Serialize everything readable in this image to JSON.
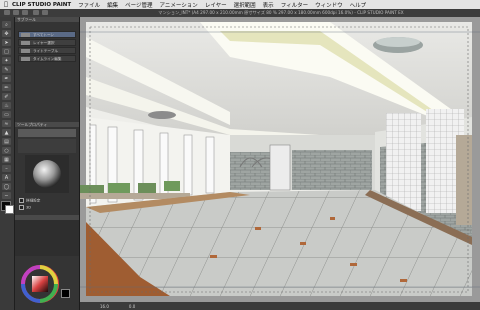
{
  "menubar": {
    "app_name": "CLIP STUDIO PAINT",
    "items": [
      "ファイル",
      "編集",
      "ページ管理",
      "アニメーション",
      "レイヤー",
      "選択範囲",
      "表示",
      "フィルター",
      "ウィンドウ",
      "ヘルプ"
    ]
  },
  "window": {
    "title": "マンション_INT* (A4 297.00 x 210.00mm 原寸サイズ 80 % 297.00 x 180.00mm 600dpi 16.0%) - CLIP STUDIO PAINT EX"
  },
  "subtool_panel": {
    "header": "サブツール",
    "items": [
      "すべてトーン",
      "レイヤー選択",
      "ライトテーブル",
      "タイムライン編集"
    ]
  },
  "tool_property": {
    "header": "ツールプロパティ",
    "items": [
      "詳細設定",
      "3D"
    ]
  },
  "status": {
    "zoom": "16.0",
    "angle": "0.0"
  },
  "colors": {
    "menubar_bg": "#e4e4e4",
    "panel_bg": "#343434",
    "accent": "#5a6a86"
  },
  "icons": [
    "apple-icon",
    "pen-tool-icon",
    "eraser-tool-icon",
    "selection-tool-icon",
    "move-tool-icon",
    "fill-tool-icon",
    "color-wheel-icon"
  ]
}
